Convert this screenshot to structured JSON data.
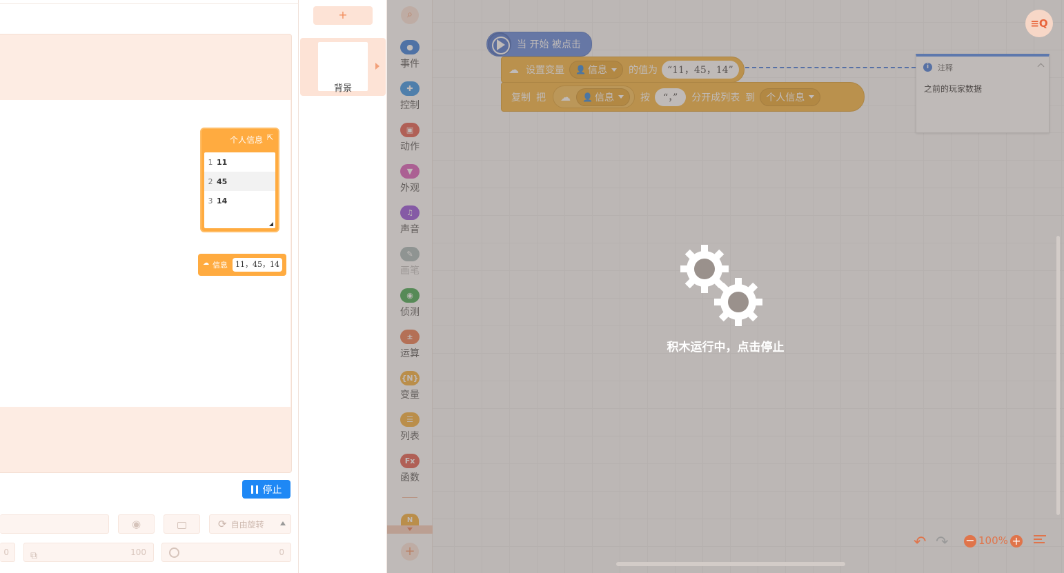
{
  "stage": {
    "list_monitor": {
      "title": "个人信息",
      "items": [
        {
          "index": "1",
          "value": "11"
        },
        {
          "index": "2",
          "value": "45"
        },
        {
          "index": "3",
          "value": "14"
        }
      ]
    },
    "variable_monitor": {
      "label": "信息",
      "value": "11，45，14"
    },
    "stop_label": "停止"
  },
  "sprite_props": {
    "rotation_label": "自由旋转",
    "x_value": "0",
    "size_value": "100",
    "direction_value": "0"
  },
  "backdrop": {
    "add_label": "+",
    "card_label": "背景"
  },
  "palette": {
    "categories": [
      {
        "label": "事件",
        "color": "#1e6fd9",
        "icon": "event-icon"
      },
      {
        "label": "控制",
        "color": "#1e88e5",
        "icon": "control-icon"
      },
      {
        "label": "动作",
        "color": "#e04b3a",
        "icon": "motion-icon"
      },
      {
        "label": "外观",
        "color": "#d74bb4",
        "icon": "looks-icon"
      },
      {
        "label": "声音",
        "color": "#8b3fd9",
        "icon": "sound-icon"
      },
      {
        "label": "画笔",
        "color": "#9fb3b3",
        "icon": "pen-icon"
      },
      {
        "label": "侦测",
        "color": "#2e9f3d",
        "icon": "sensing-icon"
      },
      {
        "label": "运算",
        "color": "#e86a3a",
        "icon": "operators-icon"
      },
      {
        "label": "变量",
        "color": "#f5a623",
        "icon": "variables-icon"
      },
      {
        "label": "列表",
        "color": "#f5a623",
        "icon": "lists-icon"
      },
      {
        "label": "函数",
        "color": "#e04b3a",
        "icon": "functions-icon"
      }
    ],
    "more_label": "N"
  },
  "blocks": {
    "hat": "当 开始 被点击",
    "set_var": {
      "prefix": "设置变量",
      "var": "信息",
      "mid": "的值为",
      "value": "“11，45，14”"
    },
    "split": {
      "copy": "复制",
      "ba": "把",
      "var": "信息",
      "an": "按",
      "sep": "“，”",
      "action": "分开成列表",
      "to": "到",
      "target": "个人信息"
    }
  },
  "comment": {
    "title": "注释",
    "text": "之前的玩家数据"
  },
  "overlay": {
    "message": "积木运行中，点击停止"
  },
  "workspace": {
    "zoom": "100%"
  }
}
